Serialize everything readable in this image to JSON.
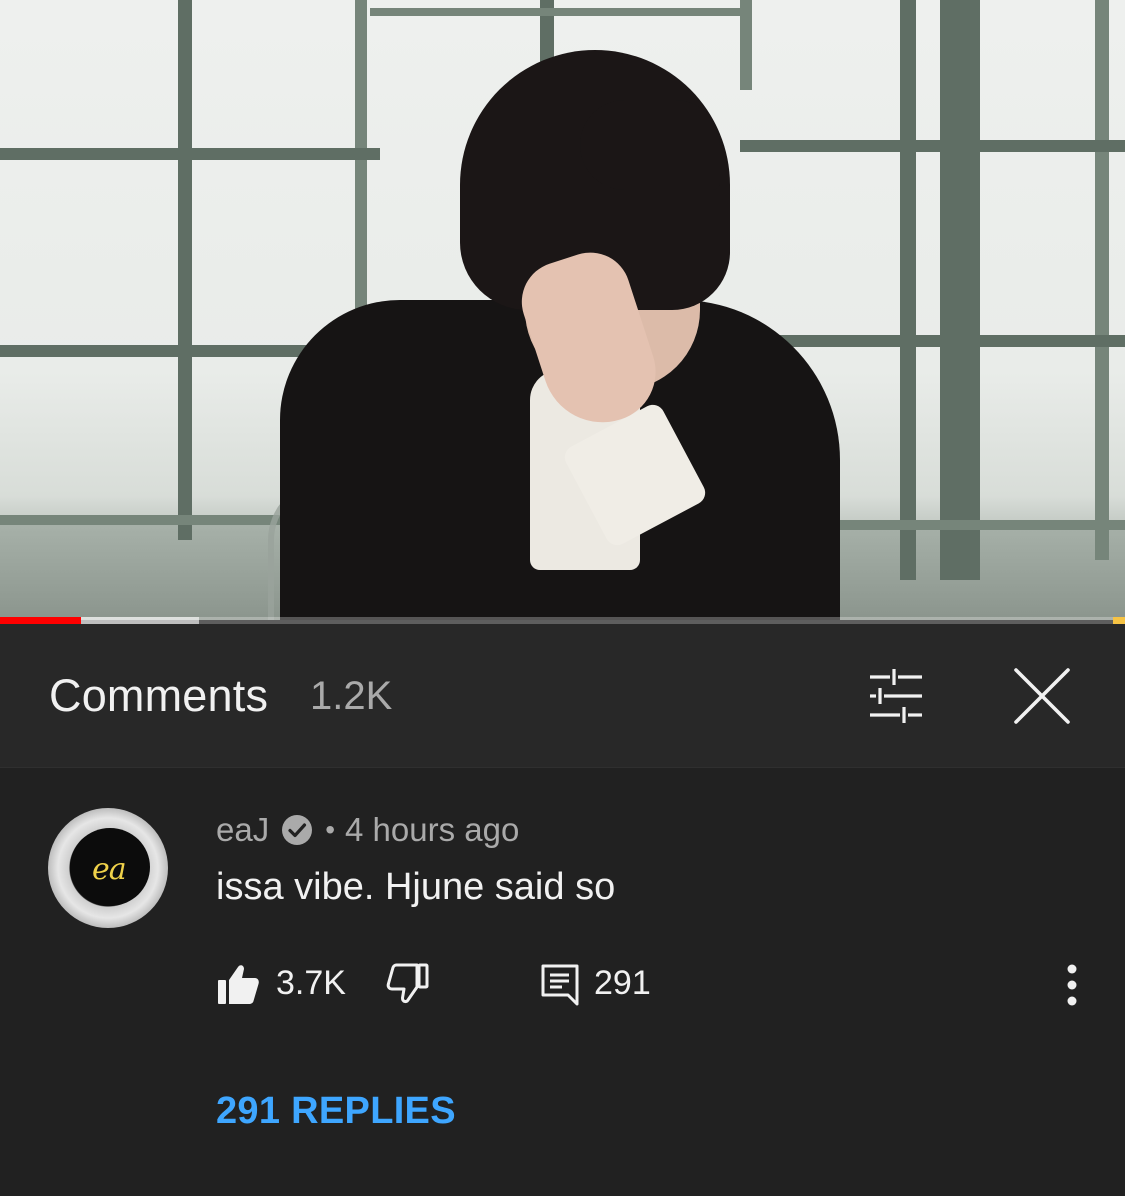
{
  "video": {
    "progress_played": 0.072,
    "progress_buffered": 0.177
  },
  "header": {
    "title": "Comments",
    "count": "1.2K"
  },
  "comment": {
    "author": "eaJ",
    "avatar_label": "ea",
    "separator": "•",
    "timestamp": "4 hours ago",
    "text": "issa vibe. Hjune said so",
    "like_count": "3.7K",
    "reply_count": "291",
    "replies_link": "291 REPLIES"
  },
  "icons": {
    "sort": "sort-filter-icon",
    "close": "close-icon",
    "verified": "verified-check-icon",
    "like": "thumb-up-icon",
    "dislike": "thumb-down-icon",
    "reply": "reply-comment-icon",
    "more": "more-vertical-icon"
  },
  "colors": {
    "background": "#212121",
    "header_background": "#282828",
    "progress_played": "#ff0000",
    "link": "#3ea6ff",
    "secondary_text": "#aaaaaa"
  }
}
